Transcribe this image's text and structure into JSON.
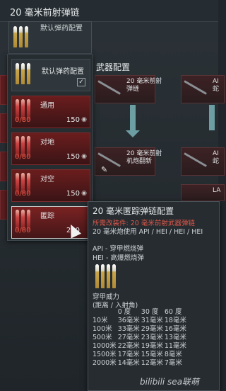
{
  "header": {
    "title": "20 毫米前射弹链"
  },
  "selected_slot": {
    "label": "默认弹药配置"
  },
  "dropdown": {
    "items": [
      {
        "name": "默认弹药配置",
        "count": "",
        "qty": "",
        "checked": true
      },
      {
        "name": "通用",
        "count": "0/80",
        "qty": "150"
      },
      {
        "name": "对地",
        "count": "0/80",
        "qty": "150"
      },
      {
        "name": "对空",
        "count": "0/80",
        "qty": "150"
      },
      {
        "name": "匿踪",
        "count": "0/80",
        "qty": "220"
      }
    ]
  },
  "weapons": {
    "title": "武器配置",
    "cards": [
      {
        "name": "20 毫米前射\n弹链"
      },
      {
        "name": "AI\n蛇"
      },
      {
        "name": "20 毫米前射\n机炮翻新"
      },
      {
        "name": "AI\n蛇"
      },
      {
        "name": "LA"
      }
    ]
  },
  "tooltip": {
    "title": "20 毫米匿踪弹链配置",
    "requirement": "所需改装件: 20 毫米前射武器弹链",
    "usage": "20 毫米炮使用 API / HEI / HEI / HEI",
    "legend": [
      "API - 穿甲燃烧弹",
      "HEI - 高爆燃烧弹"
    ],
    "pen_title": "穿甲威力",
    "pen_subtitle": "(距离 / 入射角)",
    "pen_header": [
      "",
      "0 度",
      "30 度",
      "60 度"
    ],
    "pen_rows": [
      [
        "10米",
        "36毫米",
        "31毫米",
        "18毫米"
      ],
      [
        "100米",
        "33毫米",
        "29毫米",
        "16毫米"
      ],
      [
        "500米",
        "27毫米",
        "23毫米",
        "13毫米"
      ],
      [
        "1000米",
        "22毫米",
        "19毫米",
        "11毫米"
      ],
      [
        "1500米",
        "17毫米",
        "15毫米",
        "8毫米"
      ],
      [
        "2000米",
        "14毫米",
        "12毫米",
        "7毫米"
      ]
    ]
  },
  "watermark": "bilibili  sea联萌"
}
